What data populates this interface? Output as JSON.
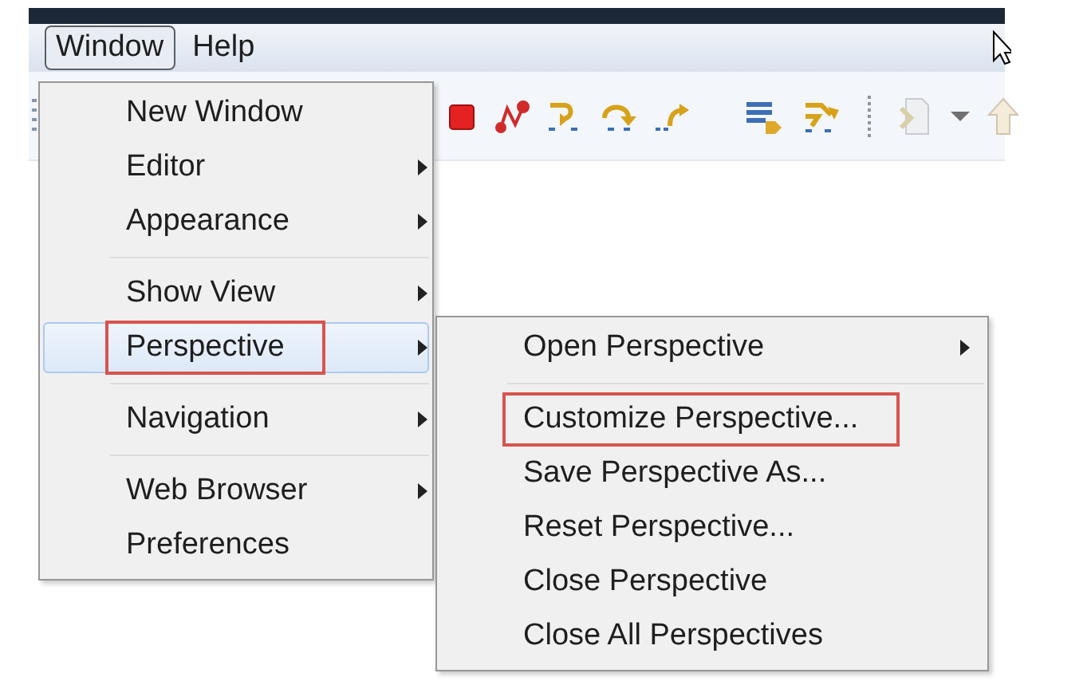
{
  "menubar": [
    {
      "label": "Window",
      "selected": true
    },
    {
      "label": "Help",
      "selected": false
    }
  ],
  "window_menu": {
    "sections": [
      [
        {
          "label": "New Window",
          "submenu": false,
          "selected": false,
          "outlined": false
        },
        {
          "label": "Editor",
          "submenu": true,
          "selected": false,
          "outlined": false
        },
        {
          "label": "Appearance",
          "submenu": true,
          "selected": false,
          "outlined": false
        }
      ],
      [
        {
          "label": "Show View",
          "submenu": true,
          "selected": false,
          "outlined": false
        },
        {
          "label": "Perspective",
          "submenu": true,
          "selected": true,
          "outlined": true
        }
      ],
      [
        {
          "label": "Navigation",
          "submenu": true,
          "selected": false,
          "outlined": false
        }
      ],
      [
        {
          "label": "Web Browser",
          "submenu": true,
          "selected": false,
          "outlined": false
        },
        {
          "label": "Preferences",
          "submenu": false,
          "selected": false,
          "outlined": false
        }
      ]
    ]
  },
  "perspective_menu": {
    "sections": [
      [
        {
          "label": "Open Perspective",
          "submenu": true,
          "selected": false,
          "outlined": false
        }
      ],
      [
        {
          "label": "Customize Perspective...",
          "submenu": false,
          "selected": false,
          "outlined": true
        },
        {
          "label": "Save Perspective As...",
          "submenu": false,
          "selected": false,
          "outlined": false
        },
        {
          "label": "Reset Perspective...",
          "submenu": false,
          "selected": false,
          "outlined": false
        },
        {
          "label": "Close Perspective",
          "submenu": false,
          "selected": false,
          "outlined": false
        },
        {
          "label": "Close All Perspectives",
          "submenu": false,
          "selected": false,
          "outlined": false
        }
      ]
    ]
  }
}
